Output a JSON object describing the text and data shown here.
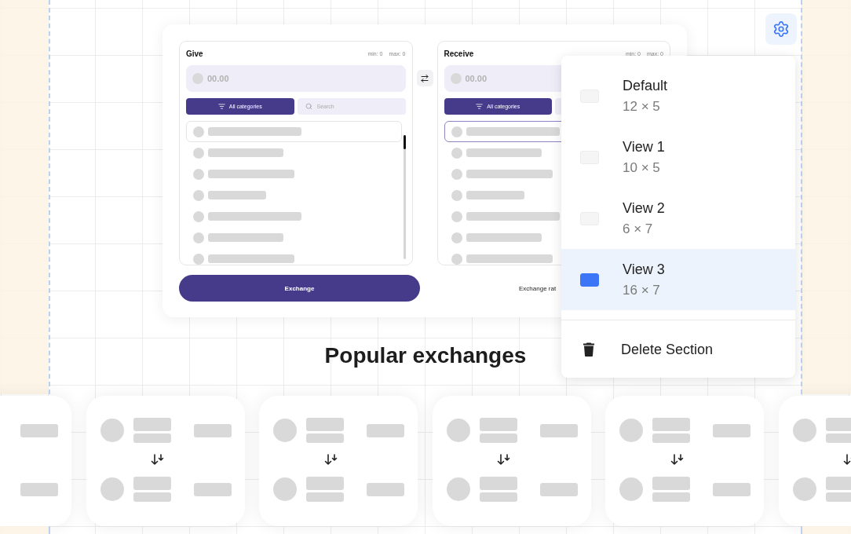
{
  "exchange_widget": {
    "panels": [
      {
        "title": "Give",
        "min": "min: 0",
        "max": "max: 0",
        "amount_placeholder": "00.00",
        "category_button": "All categories",
        "search_placeholder": "Search",
        "rows": [
          {
            "selected": false,
            "hovered": true
          },
          {
            "selected": false,
            "hovered": false
          },
          {
            "selected": false,
            "hovered": false
          },
          {
            "selected": false,
            "hovered": false
          },
          {
            "selected": false,
            "hovered": false
          },
          {
            "selected": false,
            "hovered": false
          },
          {
            "selected": false,
            "hovered": false
          }
        ]
      },
      {
        "title": "Receive",
        "min": "min: 0",
        "max": "max: 0",
        "amount_placeholder": "00.00",
        "category_button": "All categories",
        "rows": [
          {
            "selected": true,
            "hovered": false
          },
          {
            "selected": false,
            "hovered": false
          },
          {
            "selected": false,
            "hovered": false
          },
          {
            "selected": false,
            "hovered": false
          },
          {
            "selected": false,
            "hovered": false
          },
          {
            "selected": false,
            "hovered": false
          },
          {
            "selected": false,
            "hovered": false
          }
        ]
      }
    ],
    "exchange_button": "Exchange",
    "rate_label": "Exchange rat"
  },
  "layout_menu": {
    "options": [
      {
        "label": "Default",
        "size": "12 × 5",
        "selected": false
      },
      {
        "label": "View 1",
        "size": "10 × 5",
        "selected": false
      },
      {
        "label": "View 2",
        "size": "6 × 7",
        "selected": false
      },
      {
        "label": "View 3",
        "size": "16 × 7",
        "selected": true
      }
    ],
    "actions": [
      {
        "kind": "delete",
        "label": "Delete Section"
      }
    ]
  },
  "popular": {
    "title": "Popular exchanges",
    "cards": [
      {
        "kind": "cut_left"
      },
      {
        "kind": "pair"
      },
      {
        "kind": "pair"
      },
      {
        "kind": "pair"
      },
      {
        "kind": "pair"
      },
      {
        "kind": "cut_right"
      }
    ]
  }
}
